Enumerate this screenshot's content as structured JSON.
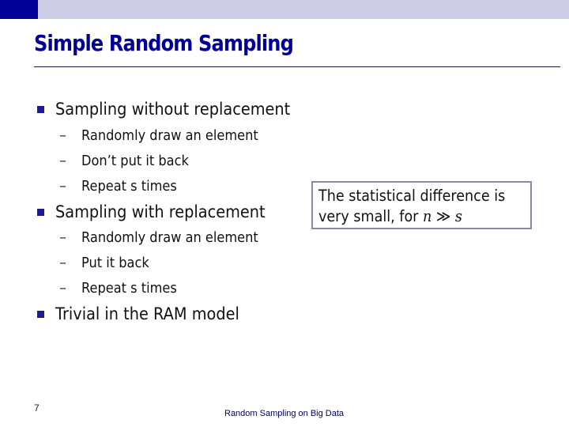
{
  "slide": {
    "title": "Simple Random Sampling",
    "bullets": [
      {
        "text": "Sampling without replacement",
        "subitems": [
          "Randomly draw an element",
          "Don’t put it back",
          "Repeat s times"
        ]
      },
      {
        "text": "Sampling with replacement",
        "subitems": [
          "Randomly draw an element",
          "Put it back",
          "Repeat s times"
        ]
      },
      {
        "text": "Trivial in the RAM model",
        "subitems": []
      }
    ],
    "callout": {
      "line1": "The statistical difference is",
      "line2_prefix": "very small, for ",
      "math_n": "n",
      "math_op": " ≫ ",
      "math_s": "s"
    },
    "slide_number": "7",
    "footer": "Random Sampling on Big Data",
    "colors": {
      "title": "#000099",
      "topbar": "#cccce6",
      "accent_block": "#000099",
      "bullet": "#1a1a9a"
    },
    "sub_dash": "–"
  }
}
